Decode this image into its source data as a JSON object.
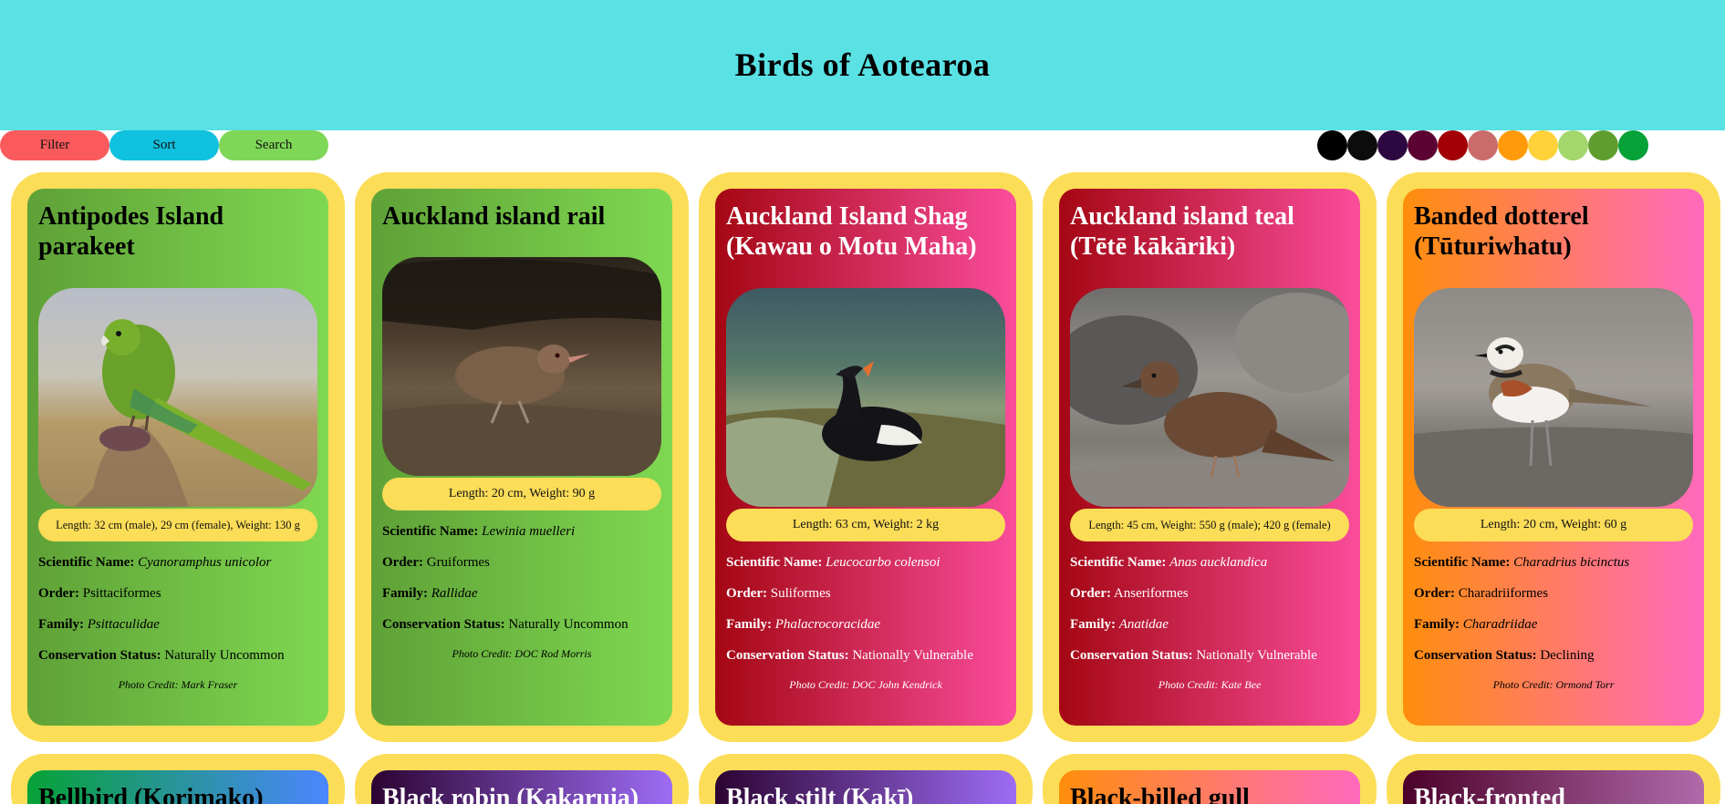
{
  "title": "Birds of Aotearoa",
  "controls": {
    "filter": "Filter",
    "sort": "Sort",
    "search": "Search"
  },
  "control_colors": {
    "filter": "#fb5a5d",
    "sort": "#0fc1de",
    "search": "#7fd757"
  },
  "swatches": [
    "#000000",
    "#0c0c0c",
    "#2d0740",
    "#5b0232",
    "#a20006",
    "#c96c6a",
    "#ff9a0a",
    "#ffd23a",
    "#a3d66b",
    "#5f9e2e",
    "#06a137"
  ],
  "labels": {
    "scientific": "Scientific Name:",
    "order": "Order:",
    "family": "Family:",
    "status": "Conservation Status:"
  },
  "birds": [
    {
      "name": "Antipodes Island parakeet",
      "stats": "Length: 32 cm (male), 29 cm (female), Weight: 130 g",
      "scientific": "Cyanoramphus unicolor",
      "order": "Psittaciformes",
      "family": "Psittaculidae",
      "status": "Naturally Uncommon",
      "credit": "Photo Credit: Mark Fraser"
    },
    {
      "name": "Auckland island rail",
      "stats": "Length: 20 cm, Weight: 90 g",
      "scientific": "Lewinia muelleri",
      "order": "Gruiformes",
      "family": "Rallidae",
      "status": "Naturally Uncommon",
      "credit": "Photo Credit: DOC Rod Morris"
    },
    {
      "name": "Auckland Island Shag (Kawau o Motu Maha)",
      "stats": "Length: 63 cm, Weight: 2 kg",
      "scientific": "Leucocarbo colensoi",
      "order": "Suliformes",
      "family": "Phalacrocoracidae",
      "status": "Nationally Vulnerable",
      "credit": "Photo Credit: DOC John Kendrick"
    },
    {
      "name": "Auckland island teal (Tētē kākāriki)",
      "stats": "Length: 45 cm, Weight: 550 g (male); 420 g (female)",
      "scientific": "Anas aucklandica",
      "order": "Anseriformes",
      "family": "Anatidae",
      "status": "Nationally Vulnerable",
      "credit": "Photo Credit: Kate Bee"
    },
    {
      "name": "Banded dotterel (Tūturiwhatu)",
      "stats": "Length: 20 cm, Weight: 60 g",
      "scientific": "Charadrius bicinctus",
      "order": "Charadriiformes",
      "family": "Charadriidae",
      "status": "Declining",
      "credit": "Photo Credit: Ormond Torr"
    },
    {
      "name": "Bellbird (Korimako)"
    },
    {
      "name": "Black robin (Kakaruia)"
    },
    {
      "name": "Black stilt (Kakī)"
    },
    {
      "name": "Black-billed gull"
    },
    {
      "name": "Black-fronted"
    }
  ]
}
